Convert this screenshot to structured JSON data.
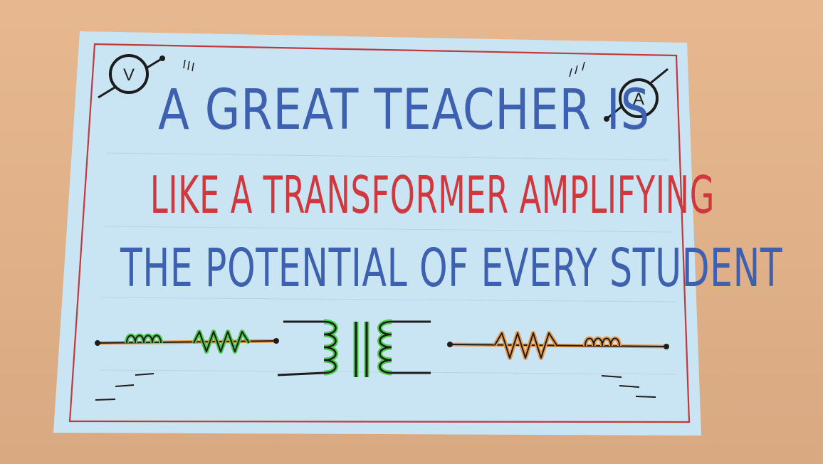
{
  "poster": {
    "line1": "A GREAT TEACHER IS",
    "line2": "LIKE A TRANSFORMER AMPLIFYING",
    "line3": "THE POTENTIAL OF EVERY STUDENT",
    "voltmeter_letter": "V",
    "ammeter_letter": "A"
  },
  "colors": {
    "wall": "#e3b48b",
    "paper": "#c9e4f2",
    "border_red": "#c0393d",
    "blue_text": "#3e60b0",
    "red_text": "#d0383e",
    "green_marker": "#4cc84a",
    "orange_marker": "#e89a4a",
    "ink": "#1c1c1c"
  },
  "icons": [
    "voltmeter-icon",
    "ammeter-icon",
    "inductor-icon",
    "resistor-icon",
    "transformer-icon",
    "ground-icon"
  ]
}
